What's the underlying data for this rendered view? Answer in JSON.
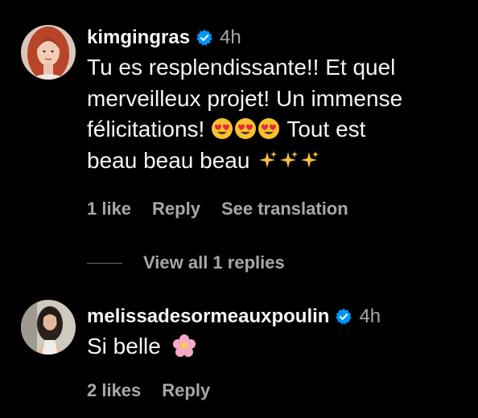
{
  "comments": [
    {
      "username": "kimgingras",
      "time": "4h",
      "text_lines": [
        "Tu es resplendissante!! Et quel",
        "merveilleux projet! Un immense",
        "félicitations!",
        "Tout est",
        "beau beau beau"
      ],
      "likes": "1 like",
      "reply": "Reply",
      "translate": "See translation",
      "avatar_icon": "profile-photo-red-hair"
    },
    {
      "username": "melissadesormeauxpoulin",
      "time": "4h",
      "text": "Si belle",
      "likes": "2 likes",
      "reply": "Reply",
      "avatar_icon": "profile-photo-dark-hair"
    }
  ],
  "replies_toggle": "View all 1 replies",
  "colors": {
    "background": "#000000",
    "primary_text": "#f5f5f5",
    "secondary_text": "#a8a8a8",
    "verified_badge": "#0095f6"
  },
  "emoji": {
    "heart_eyes": "heart-eyes-emoji",
    "sparkles": "sparkles-emoji",
    "blossom": "cherry-blossom-emoji"
  }
}
